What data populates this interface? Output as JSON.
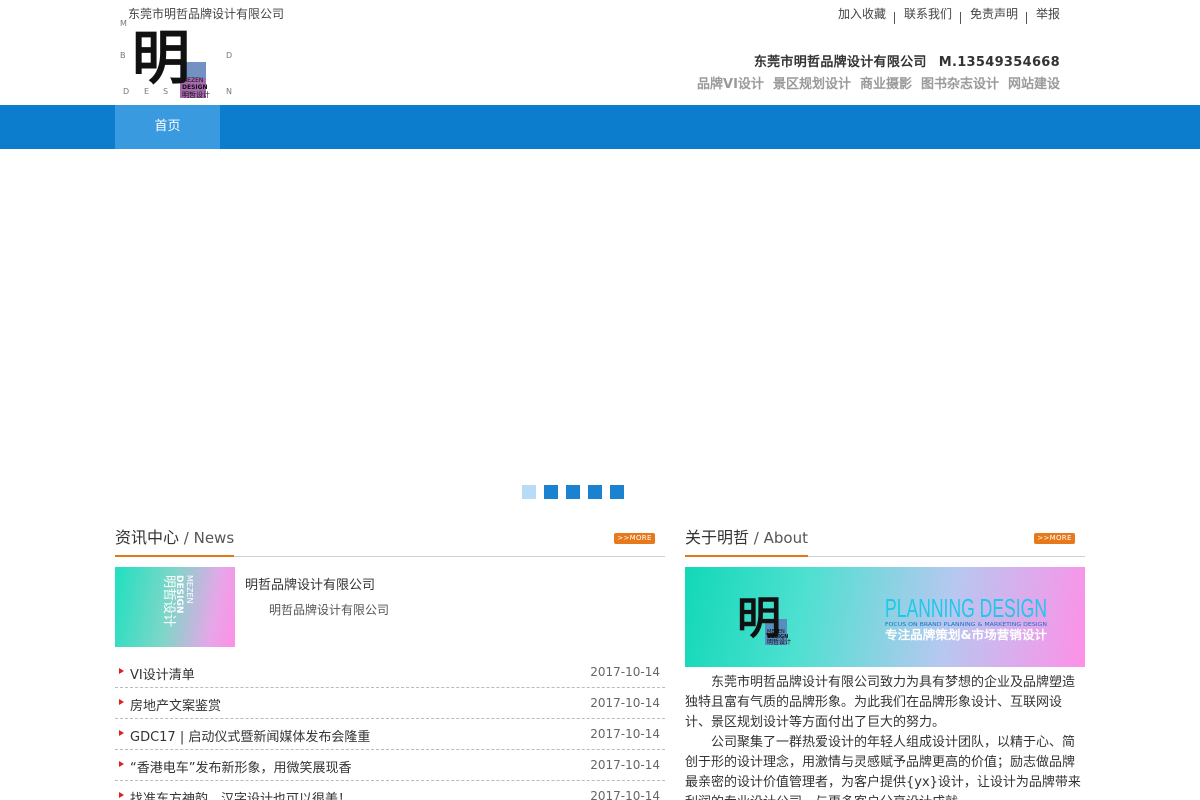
{
  "header": {
    "company_top": "东莞市明哲品牌设计有限公司",
    "logo": {
      "mark": "明",
      "letters": [
        "M",
        "I",
        "N",
        "B",
        "A",
        "N",
        "D",
        "D",
        "E",
        "S",
        "I",
        "N"
      ],
      "sub1": "MEZEN",
      "sub2": "DESIGN",
      "sub3": "明哲设计"
    },
    "top_links": [
      "加入收藏",
      "联系我们",
      "免责声明",
      "举报"
    ],
    "contact_company": "东莞市明哲品牌设计有限公司",
    "contact_phone": "M.13549354668",
    "services": [
      "品牌VI设计",
      "景区规划设计",
      "商业摄影",
      "图书杂志设计",
      "网站建设"
    ]
  },
  "nav": {
    "home": "首页"
  },
  "banner": {
    "dots_count": 5,
    "active_dot": 0
  },
  "news": {
    "title_cn": "资讯中心",
    "title_en": " / News",
    "more": ">>MORE",
    "thumb_text": {
      "v1": "MEZEN",
      "v2": "DESIGN",
      "v3": "明哲设计"
    },
    "featured_title": "明哲品牌设计有限公司",
    "featured_desc": "明哲品牌设计有限公司",
    "items": [
      {
        "title": "VI设计清单",
        "date": "2017-10-14"
      },
      {
        "title": "房地产文案鉴赏",
        "date": "2017-10-14"
      },
      {
        "title": "GDC17 | 启动仪式暨新闻媒体发布会隆重",
        "date": "2017-10-14"
      },
      {
        "title": "“香港电车”发布新形象，用微笑展现香",
        "date": "2017-10-14"
      },
      {
        "title": "找准东方神韵，汉字设计也可以很美！",
        "date": "2017-10-14"
      }
    ]
  },
  "about": {
    "title_cn": "关于明哲",
    "title_en": " / About",
    "more": ">>MORE",
    "banner_mark": "明",
    "banner_sub1": "MEZEN",
    "banner_sub2": "DESIGN",
    "banner_sub3": "明哲设计",
    "banner_en": "PLANNING DESIGN",
    "banner_small": "FOCUS ON BRAND PLANNING & MARKETING DESIGN",
    "banner_cn": "专注品牌策划&市场营销设计",
    "para1": "东莞市明哲品牌设计有限公司致力为具有梦想的企业及品牌塑造独特且富有气质的品牌形象。为此我们在品牌形象设计、互联网设计、景区规划设计等方面付出了巨大的努力。",
    "para2": "公司聚集了一群热爱设计的年轻人组成设计团队，以精于心、简创于形的设计理念，用激情与灵感赋予品牌更高的价值；励志做品牌最亲密的设计价值管理者，为客户提供{yx}设计，让设计为品牌带来利润的专业设计公司。与更多客户分享设计成就。"
  }
}
